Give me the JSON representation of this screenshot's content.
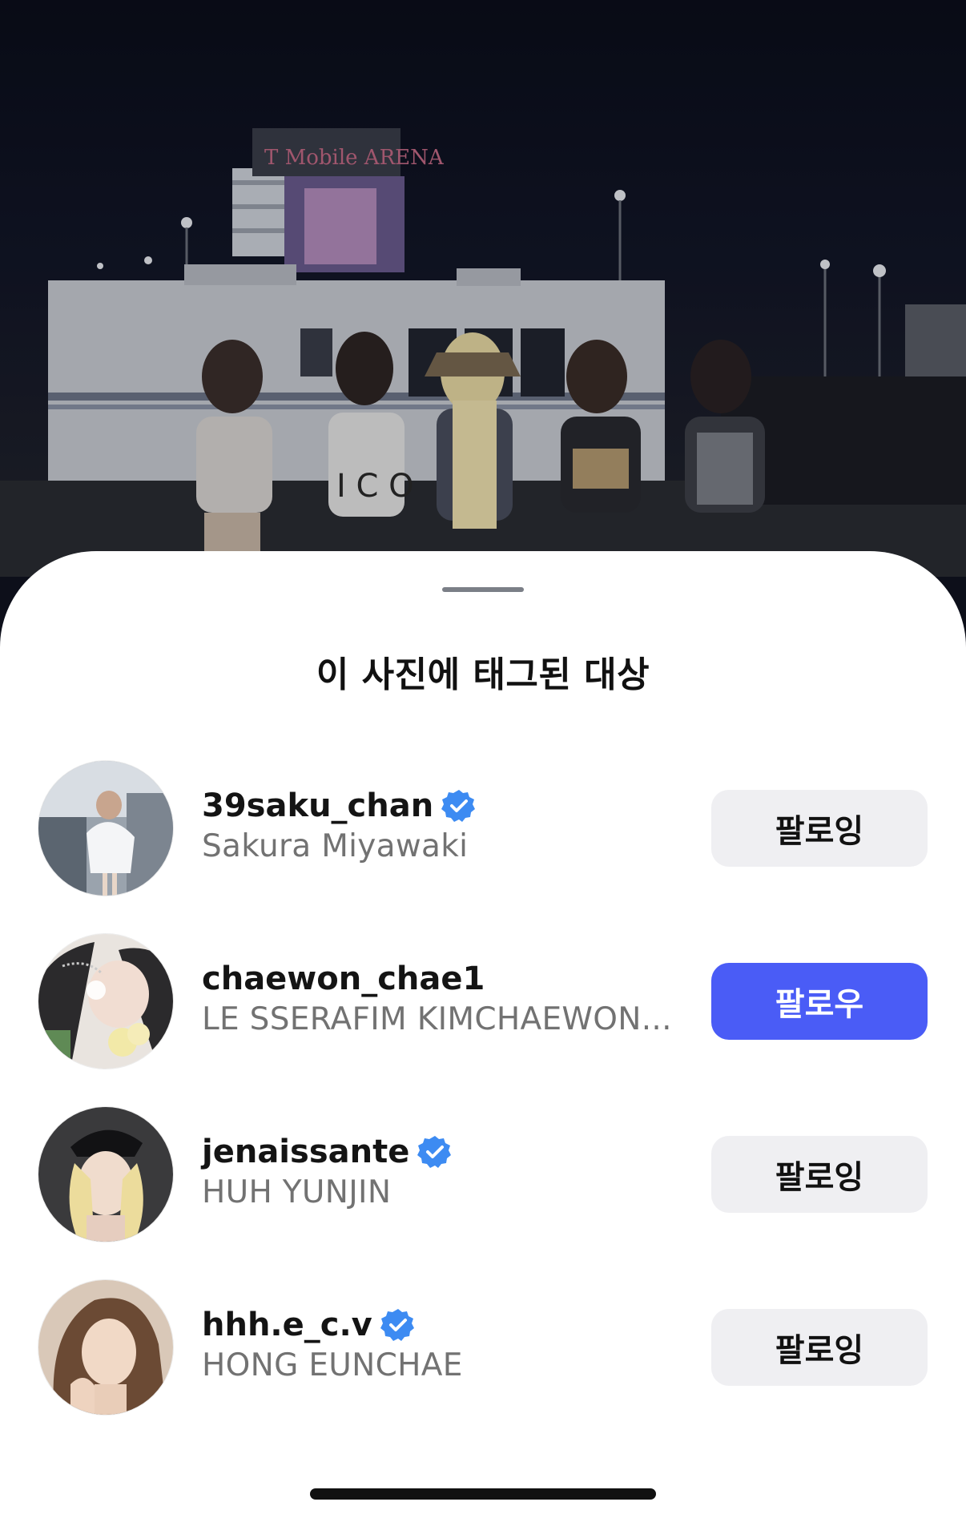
{
  "sheet": {
    "title": "이 사진에 태그된 대상"
  },
  "arena_sign": "T Mobile ARENA",
  "colors": {
    "follow_button": "#4a5cf6",
    "following_button": "#efeff2",
    "verified_badge": "#3d8bf2"
  },
  "users": [
    {
      "username": "39saku_chan",
      "fullname": "Sakura Miyawaki",
      "verified": true,
      "button_label": "팔로잉",
      "button_state": "following"
    },
    {
      "username": "chaewon_chae1",
      "fullname": "LE SSERAFIM KIMCHAEWON...",
      "verified": false,
      "button_label": "팔로우",
      "button_state": "follow"
    },
    {
      "username": "jenaissante",
      "fullname": "HUH YUNJIN",
      "verified": true,
      "button_label": "팔로잉",
      "button_state": "following"
    },
    {
      "username": "hhh.e_c.v",
      "fullname": "HONG EUNCHAE",
      "verified": true,
      "button_label": "팔로잉",
      "button_state": "following"
    }
  ]
}
